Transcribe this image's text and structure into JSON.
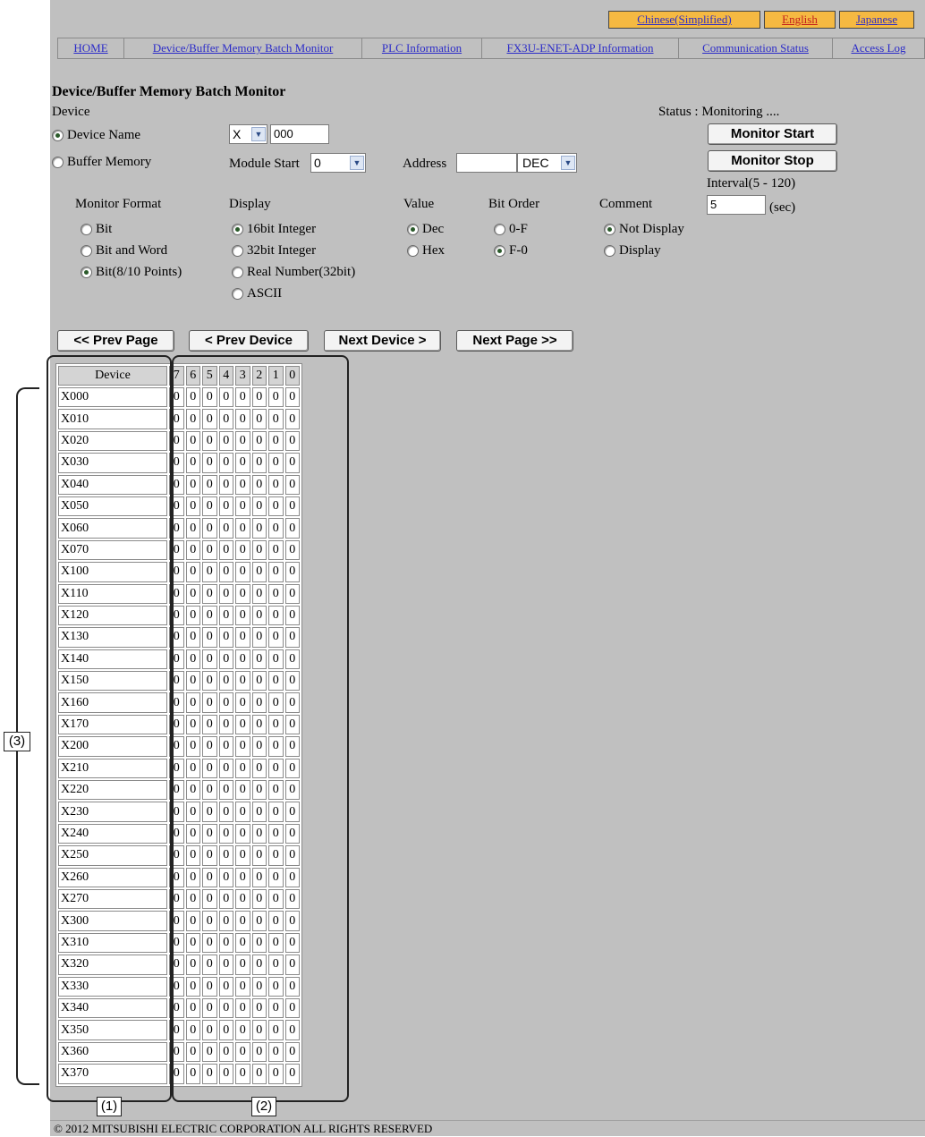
{
  "languages": [
    "Chinese(Simplified)",
    "English",
    "Japanese"
  ],
  "nav": [
    "HOME",
    "Device/Buffer Memory Batch Monitor",
    "PLC Information",
    "FX3U-ENET-ADP Information",
    "Communication Status",
    "Access Log"
  ],
  "page_title": "Device/Buffer Memory Batch Monitor",
  "device_label": "Device",
  "status_text": "Status : Monitoring ....",
  "device_name_radio": "Device Name",
  "buffer_memory_radio": "Buffer Memory",
  "device_type_value": "X",
  "device_number_value": "000",
  "module_start_label": "Module Start",
  "module_start_value": "0",
  "address_label": "Address",
  "address_value": "",
  "address_format_value": "DEC",
  "monitor_start_label": "Monitor Start",
  "monitor_stop_label": "Monitor Stop",
  "interval_label": "Interval(5 - 120)",
  "interval_value": "5",
  "interval_unit": "(sec)",
  "monitor_format": {
    "label": "Monitor Format",
    "options": [
      "Bit",
      "Bit and Word",
      "Bit(8/10 Points)"
    ],
    "selected": "Bit(8/10 Points)"
  },
  "display": {
    "label": "Display",
    "options": [
      "16bit Integer",
      "32bit Integer",
      "Real Number(32bit)",
      "ASCII"
    ],
    "selected": "16bit Integer"
  },
  "value": {
    "label": "Value",
    "options": [
      "Dec",
      "Hex"
    ],
    "selected": "Dec"
  },
  "bit_order": {
    "label": "Bit Order",
    "options": [
      "0-F",
      "F-0"
    ],
    "selected": "F-0"
  },
  "comment": {
    "label": "Comment",
    "options": [
      "Not Display",
      "Display"
    ],
    "selected": "Not Display"
  },
  "paging": {
    "prev_page": "<< Prev Page",
    "prev_device": "< Prev Device",
    "next_device": "Next Device >",
    "next_page": "Next Page >>"
  },
  "table": {
    "device_header": "Device",
    "bit_headers": [
      "7",
      "6",
      "5",
      "4",
      "3",
      "2",
      "1",
      "0"
    ],
    "rows": [
      {
        "device": "X000",
        "bits": [
          "0",
          "0",
          "0",
          "0",
          "0",
          "0",
          "0",
          "0"
        ]
      },
      {
        "device": "X010",
        "bits": [
          "0",
          "0",
          "0",
          "0",
          "0",
          "0",
          "0",
          "0"
        ]
      },
      {
        "device": "X020",
        "bits": [
          "0",
          "0",
          "0",
          "0",
          "0",
          "0",
          "0",
          "0"
        ]
      },
      {
        "device": "X030",
        "bits": [
          "0",
          "0",
          "0",
          "0",
          "0",
          "0",
          "0",
          "0"
        ]
      },
      {
        "device": "X040",
        "bits": [
          "0",
          "0",
          "0",
          "0",
          "0",
          "0",
          "0",
          "0"
        ]
      },
      {
        "device": "X050",
        "bits": [
          "0",
          "0",
          "0",
          "0",
          "0",
          "0",
          "0",
          "0"
        ]
      },
      {
        "device": "X060",
        "bits": [
          "0",
          "0",
          "0",
          "0",
          "0",
          "0",
          "0",
          "0"
        ]
      },
      {
        "device": "X070",
        "bits": [
          "0",
          "0",
          "0",
          "0",
          "0",
          "0",
          "0",
          "0"
        ]
      },
      {
        "device": "X100",
        "bits": [
          "0",
          "0",
          "0",
          "0",
          "0",
          "0",
          "0",
          "0"
        ]
      },
      {
        "device": "X110",
        "bits": [
          "0",
          "0",
          "0",
          "0",
          "0",
          "0",
          "0",
          "0"
        ]
      },
      {
        "device": "X120",
        "bits": [
          "0",
          "0",
          "0",
          "0",
          "0",
          "0",
          "0",
          "0"
        ]
      },
      {
        "device": "X130",
        "bits": [
          "0",
          "0",
          "0",
          "0",
          "0",
          "0",
          "0",
          "0"
        ]
      },
      {
        "device": "X140",
        "bits": [
          "0",
          "0",
          "0",
          "0",
          "0",
          "0",
          "0",
          "0"
        ]
      },
      {
        "device": "X150",
        "bits": [
          "0",
          "0",
          "0",
          "0",
          "0",
          "0",
          "0",
          "0"
        ]
      },
      {
        "device": "X160",
        "bits": [
          "0",
          "0",
          "0",
          "0",
          "0",
          "0",
          "0",
          "0"
        ]
      },
      {
        "device": "X170",
        "bits": [
          "0",
          "0",
          "0",
          "0",
          "0",
          "0",
          "0",
          "0"
        ]
      },
      {
        "device": "X200",
        "bits": [
          "0",
          "0",
          "0",
          "0",
          "0",
          "0",
          "0",
          "0"
        ]
      },
      {
        "device": "X210",
        "bits": [
          "0",
          "0",
          "0",
          "0",
          "0",
          "0",
          "0",
          "0"
        ]
      },
      {
        "device": "X220",
        "bits": [
          "0",
          "0",
          "0",
          "0",
          "0",
          "0",
          "0",
          "0"
        ]
      },
      {
        "device": "X230",
        "bits": [
          "0",
          "0",
          "0",
          "0",
          "0",
          "0",
          "0",
          "0"
        ]
      },
      {
        "device": "X240",
        "bits": [
          "0",
          "0",
          "0",
          "0",
          "0",
          "0",
          "0",
          "0"
        ]
      },
      {
        "device": "X250",
        "bits": [
          "0",
          "0",
          "0",
          "0",
          "0",
          "0",
          "0",
          "0"
        ]
      },
      {
        "device": "X260",
        "bits": [
          "0",
          "0",
          "0",
          "0",
          "0",
          "0",
          "0",
          "0"
        ]
      },
      {
        "device": "X270",
        "bits": [
          "0",
          "0",
          "0",
          "0",
          "0",
          "0",
          "0",
          "0"
        ]
      },
      {
        "device": "X300",
        "bits": [
          "0",
          "0",
          "0",
          "0",
          "0",
          "0",
          "0",
          "0"
        ]
      },
      {
        "device": "X310",
        "bits": [
          "0",
          "0",
          "0",
          "0",
          "0",
          "0",
          "0",
          "0"
        ]
      },
      {
        "device": "X320",
        "bits": [
          "0",
          "0",
          "0",
          "0",
          "0",
          "0",
          "0",
          "0"
        ]
      },
      {
        "device": "X330",
        "bits": [
          "0",
          "0",
          "0",
          "0",
          "0",
          "0",
          "0",
          "0"
        ]
      },
      {
        "device": "X340",
        "bits": [
          "0",
          "0",
          "0",
          "0",
          "0",
          "0",
          "0",
          "0"
        ]
      },
      {
        "device": "X350",
        "bits": [
          "0",
          "0",
          "0",
          "0",
          "0",
          "0",
          "0",
          "0"
        ]
      },
      {
        "device": "X360",
        "bits": [
          "0",
          "0",
          "0",
          "0",
          "0",
          "0",
          "0",
          "0"
        ]
      },
      {
        "device": "X370",
        "bits": [
          "0",
          "0",
          "0",
          "0",
          "0",
          "0",
          "0",
          "0"
        ]
      }
    ]
  },
  "annotations": [
    "(1)",
    "(2)",
    "(3)"
  ],
  "footer": "© 2012 MITSUBISHI ELECTRIC CORPORATION ALL RIGHTS RESERVED",
  "colors": {
    "panel": "#c0c0c0",
    "language_bar": "#f5b942",
    "link": "#2c2cc8",
    "active_language": "#c21d1d"
  },
  "icons": {
    "dropdown": "chevron-down-icon",
    "radio": "radio-icon"
  }
}
